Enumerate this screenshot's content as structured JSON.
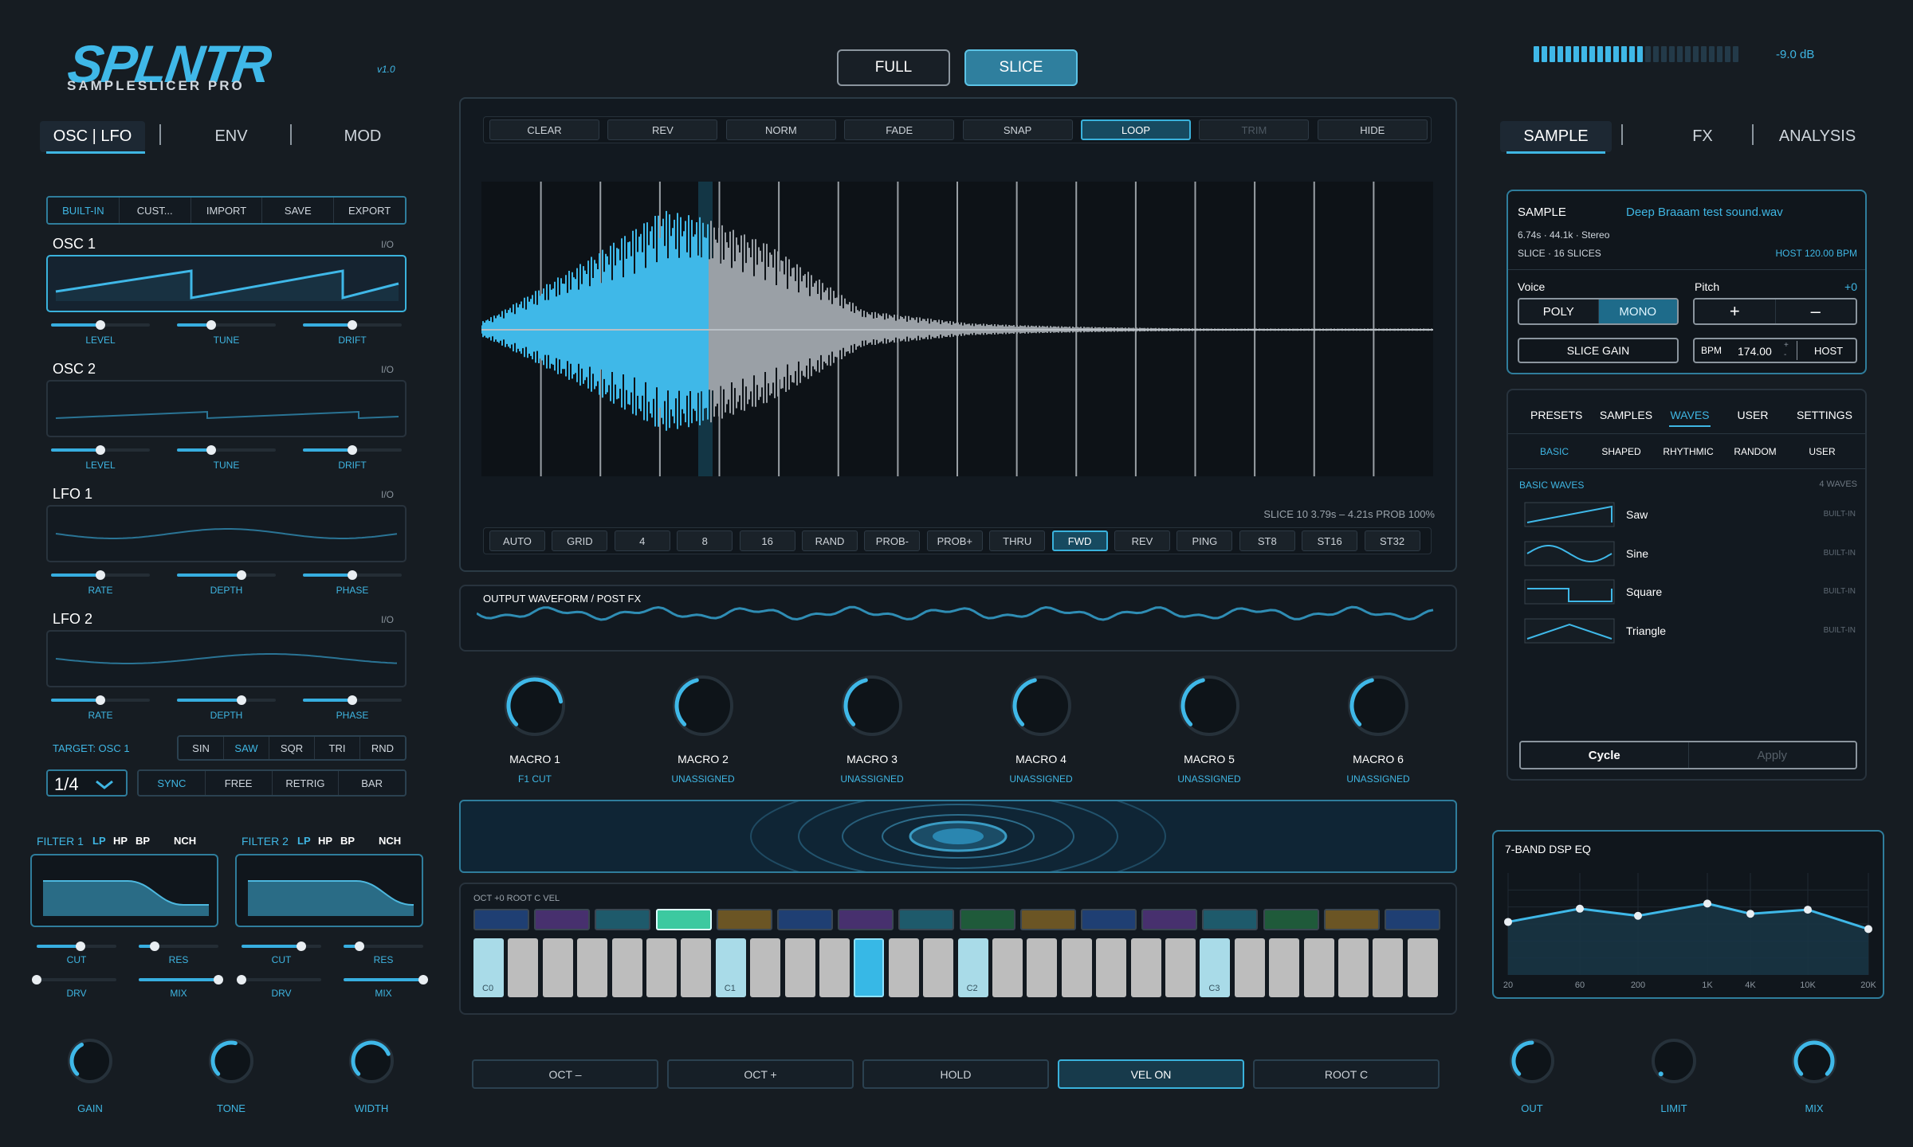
{
  "logo": {
    "name": "SPLNTR",
    "sub": "SAMPLESLICER PRO",
    "version": "v1.0"
  },
  "view_toggle": {
    "full": "FULL",
    "slice": "SLICE",
    "active": "slice"
  },
  "meter": {
    "db": "-9.0 dB",
    "level": 0.55
  },
  "left_tabs": [
    {
      "label": "OSC | LFO",
      "active": true
    },
    {
      "label": "ENV"
    },
    {
      "label": "MOD"
    }
  ],
  "right_tabs": [
    {
      "label": "SAMPLE",
      "active": true
    },
    {
      "label": "FX"
    },
    {
      "label": "ANALYSIS"
    }
  ],
  "preset_buttons": [
    "BUILT-IN",
    "CUST...",
    "IMPORT",
    "SAVE",
    "EXPORT"
  ],
  "oscillators": [
    {
      "title": "OSC 1",
      "io": "I/O",
      "params": [
        {
          "label": "LEVEL",
          "value": 0.5
        },
        {
          "label": "TUNE",
          "value": 0.35
        },
        {
          "label": "DRIFT",
          "value": 0.5
        }
      ]
    },
    {
      "title": "OSC 2",
      "io": "I/O",
      "params": [
        {
          "label": "LEVEL",
          "value": 0.5
        },
        {
          "label": "TUNE",
          "value": 0.35
        },
        {
          "label": "DRIFT",
          "value": 0.5
        }
      ]
    },
    {
      "title": "LFO 1",
      "io": "I/O",
      "params": [
        {
          "label": "RATE",
          "value": 0.5
        },
        {
          "label": "DEPTH",
          "value": 0.65
        },
        {
          "label": "PHASE",
          "value": 0.5
        }
      ]
    },
    {
      "title": "LFO 2",
      "io": "I/O",
      "params": [
        {
          "label": "RATE",
          "value": 0.5
        },
        {
          "label": "DEPTH",
          "value": 0.65
        },
        {
          "label": "PHASE",
          "value": 0.5
        }
      ]
    }
  ],
  "target": {
    "label": "TARGET: OSC 1",
    "shapes": [
      "SIN",
      "SAW",
      "SQR",
      "TRI",
      "RND"
    ],
    "active_shape": "SAW"
  },
  "rate": {
    "value": "1/4",
    "modes": [
      "SYNC",
      "FREE",
      "RETRIG",
      "BAR"
    ]
  },
  "filters": [
    {
      "title": "FILTER 1",
      "types": [
        "LP",
        "HP",
        "BP",
        "NCH"
      ],
      "knobs": [
        {
          "label": "CUT",
          "value": 0.55
        },
        {
          "label": "RES",
          "value": 0.2
        },
        {
          "label": "DRV",
          "value": 0.0
        },
        {
          "label": "MIX",
          "value": 1.0
        }
      ]
    },
    {
      "title": "FILTER 2",
      "types": [
        "LP",
        "HP",
        "BP",
        "NCH"
      ],
      "knobs": [
        {
          "label": "CUT",
          "value": 0.75
        },
        {
          "label": "RES",
          "value": 0.2
        },
        {
          "label": "DRV",
          "value": 0.0
        },
        {
          "label": "MIX",
          "value": 1.0
        }
      ]
    }
  ],
  "bottom_left_knobs": [
    {
      "label": "GAIN",
      "value": 0.4
    },
    {
      "label": "TONE",
      "value": 0.55
    },
    {
      "label": "WIDTH",
      "value": 0.75
    }
  ],
  "toolbar": [
    {
      "label": "CLEAR"
    },
    {
      "label": "REV"
    },
    {
      "label": "NORM"
    },
    {
      "label": "FADE"
    },
    {
      "label": "SNAP"
    },
    {
      "label": "LOOP",
      "state": "on"
    },
    {
      "label": "TRIM",
      "state": "off"
    },
    {
      "label": "HIDE"
    }
  ],
  "slice_info": "SLICE 10  3.79s – 4.21s  PROB 100%",
  "slice_modes": [
    {
      "label": "AUTO"
    },
    {
      "label": "GRID"
    },
    {
      "label": "4"
    },
    {
      "label": "8"
    },
    {
      "label": "16"
    },
    {
      "label": "RAND"
    },
    {
      "label": "PROB-"
    },
    {
      "label": "PROB+"
    },
    {
      "label": "THRU"
    },
    {
      "label": "FWD",
      "state": "on"
    },
    {
      "label": "REV"
    },
    {
      "label": "PING"
    },
    {
      "label": "ST8"
    },
    {
      "label": "ST16"
    },
    {
      "label": "ST32"
    }
  ],
  "output": {
    "label": "OUTPUT WAVEFORM  /  POST FX"
  },
  "macros": [
    {
      "label": "MACRO 1",
      "assign": "F1 CUT",
      "value": 0.8
    },
    {
      "label": "MACRO 2",
      "assign": "UNASSIGNED",
      "value": 0.45
    },
    {
      "label": "MACRO 3",
      "assign": "UNASSIGNED",
      "value": 0.45
    },
    {
      "label": "MACRO 4",
      "assign": "UNASSIGNED",
      "value": 0.45
    },
    {
      "label": "MACRO 5",
      "assign": "UNASSIGNED",
      "value": 0.45
    },
    {
      "label": "MACRO 6",
      "assign": "UNASSIGNED",
      "value": 0.45
    }
  ],
  "keyboard": {
    "info": "OCT +0  ROOT C  VEL",
    "notes": [
      "C0",
      "C1",
      "C2",
      "C3"
    ],
    "pad_colors": [
      "#1f3f73",
      "#47306e",
      "#1e5a6b",
      "#3cc9a0",
      "#6b5524",
      "#1f3f73",
      "#47306e",
      "#1e5a6b",
      "#1f5a3a",
      "#6b5524",
      "#1f3f73",
      "#47306e",
      "#1e5a6b",
      "#1f5a3a",
      "#6b5524",
      "#1f3f73"
    ]
  },
  "bottom_buttons": [
    {
      "label": "OCT –"
    },
    {
      "label": "OCT +"
    },
    {
      "label": "HOLD"
    },
    {
      "label": "VEL ON",
      "state": "on"
    },
    {
      "label": "ROOT C"
    }
  ],
  "sample": {
    "title": "SAMPLE",
    "file": "Deep Braaam test sound.wav",
    "line1": "6.74s  ·  44.1k  ·  Stereo",
    "line2": "SLICE  ·  16 SLICES",
    "host_bpm": "HOST  120.00 BPM",
    "voice_label": "Voice",
    "voice": [
      "POLY",
      "MONO"
    ],
    "voice_active": "MONO",
    "pitch_label": "Pitch",
    "pitch_value": "+0",
    "plus": "+",
    "minus": "–",
    "slice_gain": "SLICE GAIN",
    "bpm_label": "BPM",
    "bpm_value": "174.00",
    "host": "HOST"
  },
  "browser": {
    "tabs": [
      "PRESETS",
      "SAMPLES",
      "WAVES",
      "USER",
      "SETTINGS"
    ],
    "active_tab": "WAVES",
    "subtabs": [
      "BASIC",
      "SHAPED",
      "RHYTHMIC",
      "RANDOM",
      "USER"
    ],
    "active_subtab": "BASIC",
    "section": "BASIC WAVES",
    "count": "4 WAVES",
    "waves": [
      {
        "name": "Saw",
        "tag": "BUILT-IN"
      },
      {
        "name": "Sine",
        "tag": "BUILT-IN"
      },
      {
        "name": "Square",
        "tag": "BUILT-IN"
      },
      {
        "name": "Triangle",
        "tag": "BUILT-IN"
      }
    ],
    "cycle": "Cycle",
    "apply": "Apply"
  },
  "eq": {
    "title": "7-BAND DSP EQ",
    "freq_labels": [
      "20",
      "60",
      "200",
      "1K",
      "4K",
      "10K",
      "20K"
    ],
    "bands": [
      0.48,
      0.35,
      0.42,
      0.3,
      0.4,
      0.36,
      0.55
    ]
  },
  "bottom_right_knobs": [
    {
      "label": "OUT",
      "value": 0.5
    },
    {
      "label": "LIMIT",
      "value": 0.0
    },
    {
      "label": "MIX",
      "value": 1.0
    }
  ]
}
